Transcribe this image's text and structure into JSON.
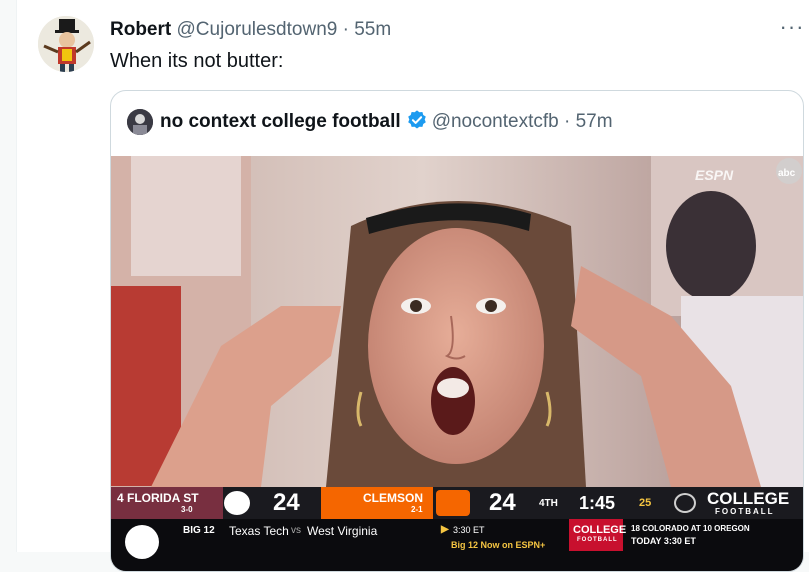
{
  "tweet": {
    "author_name": "Robert",
    "handle": "@Cujorulesdtown9",
    "separator": "·",
    "time": "55m",
    "text": "When its not butter:",
    "more_label": "···"
  },
  "quoted": {
    "author_name": "no context college football",
    "handle": "@nocontextcfb",
    "separator": "·",
    "time": "57m",
    "verified_color": "#1d9bf0"
  },
  "broadcast": {
    "network_bug": "ESPN",
    "network_bug2": "abc",
    "team1": {
      "rank_name": "4 FLORIDA ST",
      "record": "3-0",
      "score": "24"
    },
    "team2": {
      "name": "CLEMSON",
      "record": "2-1",
      "score": "24"
    },
    "quarter": "4TH",
    "clock": "1:45",
    "playclock": "25",
    "college_brand": "COLLEGE",
    "college_brand_sub": "FOOTBALL",
    "ticker": {
      "conf": "BIG 12",
      "matchup_a": "Texas Tech",
      "vs": "vs",
      "matchup_b": "West Virginia",
      "time_line": "3:30 ET",
      "espn_line": "Big 12 Now on ESPN+",
      "promo_big": "COLLEGE",
      "promo_small": "FOOTBALL",
      "next_line1": "18 COLORADO AT 10 OREGON",
      "next_line2": "TODAY 3:30 ET"
    }
  },
  "colors": {
    "florida_st": "#782f40",
    "clemson": "#f56600",
    "accent_blue": "#1d9bf0"
  }
}
